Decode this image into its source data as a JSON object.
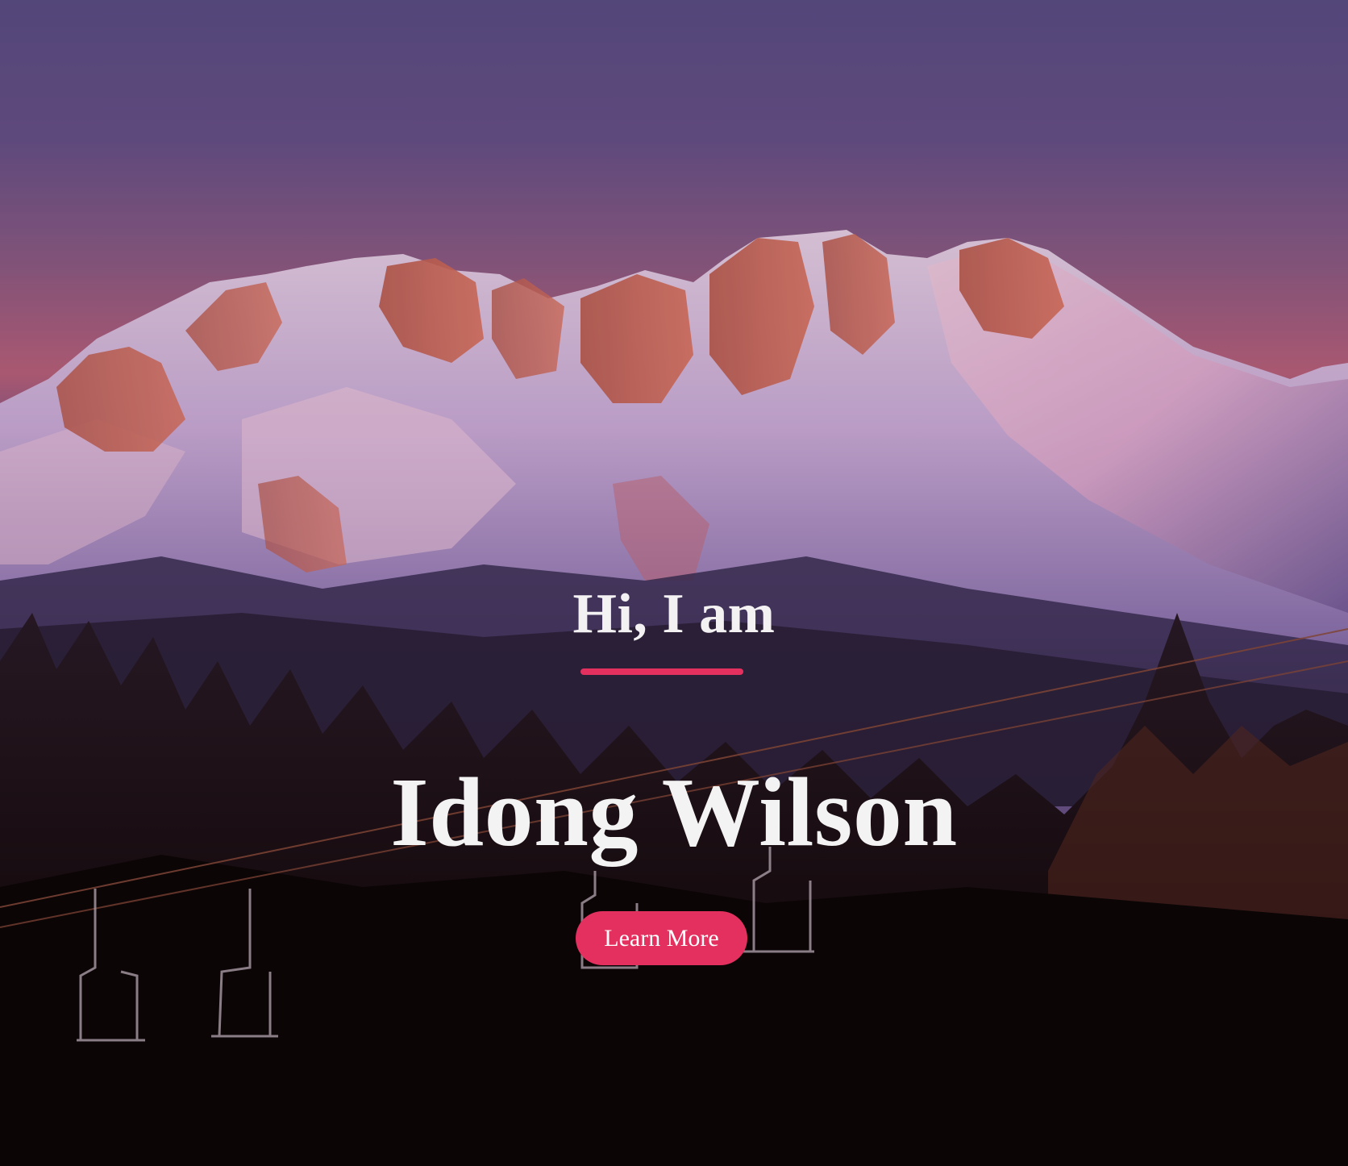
{
  "hero": {
    "greeting": "Hi, I am",
    "name": "Idong Wilson",
    "cta_label": "Learn More"
  },
  "colors": {
    "accent": "#e3305f",
    "text": "#f3f3f3",
    "sky_top": "#5b4d84",
    "sky_horizon": "#b8607a"
  }
}
